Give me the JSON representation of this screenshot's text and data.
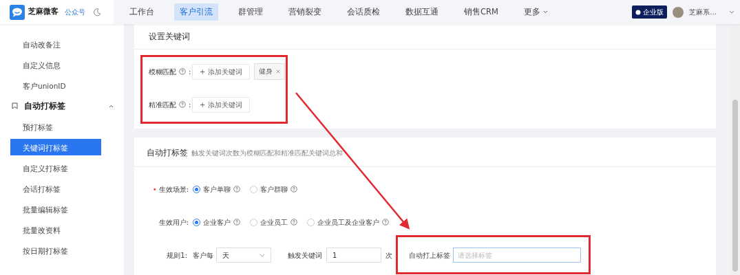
{
  "header": {
    "brand": "芝麻微客",
    "account_link": "公众号",
    "nav": [
      {
        "label": "工作台",
        "selected": false
      },
      {
        "label": "客户引流",
        "selected": true
      },
      {
        "label": "群管理",
        "selected": false
      },
      {
        "label": "营销裂变",
        "selected": false
      },
      {
        "label": "会话质检",
        "selected": false
      },
      {
        "label": "数据互通",
        "selected": false
      },
      {
        "label": "销售CRM",
        "selected": false
      }
    ],
    "more": "更多",
    "edition": "企业版",
    "user": "芝麻系..."
  },
  "sidebar": {
    "items": [
      {
        "kind": "item",
        "label": "自动改备注",
        "selected": false
      },
      {
        "kind": "item",
        "label": "自定义信息",
        "selected": false
      },
      {
        "kind": "item",
        "label": "客户unionID",
        "selected": false
      },
      {
        "kind": "group",
        "label": "自动打标签",
        "expanded": true
      },
      {
        "kind": "item",
        "label": "预打标签",
        "selected": false
      },
      {
        "kind": "item",
        "label": "关键词打标签",
        "selected": true
      },
      {
        "kind": "item",
        "label": "自定义打标签",
        "selected": false
      },
      {
        "kind": "item",
        "label": "会话打标签",
        "selected": false
      },
      {
        "kind": "item",
        "label": "批量编辑标签",
        "selected": false
      },
      {
        "kind": "item",
        "label": "批量改资料",
        "selected": false
      },
      {
        "kind": "item",
        "label": "按日期打标签",
        "selected": false
      }
    ]
  },
  "keywords": {
    "title": "设置关键词",
    "rows": [
      {
        "label": "模糊匹配",
        "colon": ":",
        "add_button": "+ 添加关键词",
        "tags": [
          "健身"
        ]
      },
      {
        "label": "精准匹配",
        "colon": ":",
        "add_button": "+ 添加关键词"
      }
    ]
  },
  "auto_tag": {
    "title": "自动打标签",
    "hint": "触发关键词次数为模糊匹配和精准匹配关键词总和",
    "scene": {
      "label": "生效场景:",
      "required_mark": "•",
      "options": [
        {
          "label": "客户单聊",
          "selected": true
        },
        {
          "label": "客户群聊",
          "selected": false
        }
      ]
    },
    "users": {
      "label": "生效用户:",
      "options": [
        {
          "label": "企业客户",
          "selected": true
        },
        {
          "label": "企业员工",
          "selected": false
        },
        {
          "label": "企业员工及企业客户",
          "selected": false
        }
      ]
    },
    "rule": {
      "label": "规则1:",
      "prefix": "客户每",
      "period": "天",
      "trigger_label": "触发关键词",
      "count": "1",
      "unit": "次",
      "tag_label": "自动打上标签",
      "tag_placeholder": "请选择标签"
    }
  }
}
